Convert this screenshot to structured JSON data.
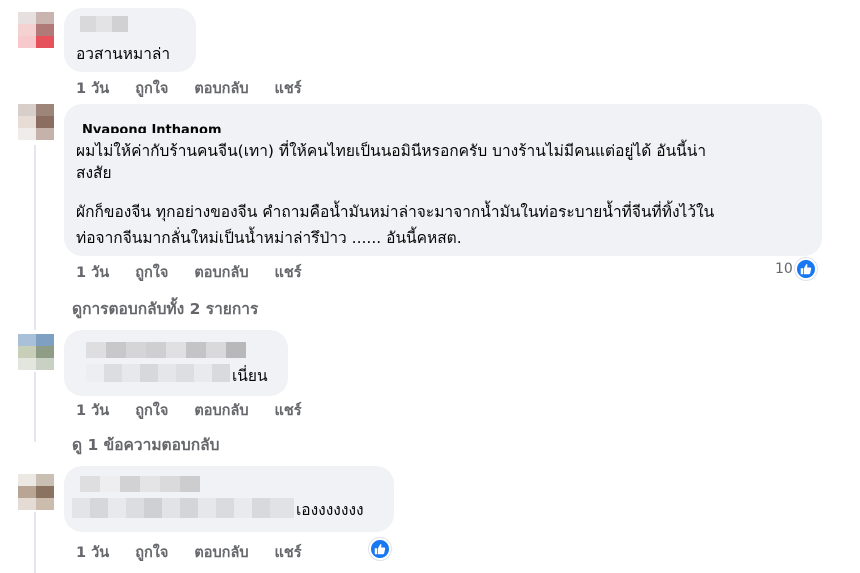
{
  "comments": [
    {
      "text_lines": [
        "อวสานหมาล่า"
      ],
      "actions": {
        "time": "1 วัน",
        "like": "ถูกใจ",
        "reply": "ตอบกลับ",
        "share": "แชร์"
      }
    },
    {
      "author_partial": "Nyapong Inthanom",
      "text_lines": [
        "ผมไม่ให้ค่ากับร้านคนจีน(เทา) ที่ให้คนไทยเป็นนอมินีหรอกครับ บางร้านไม่มีคนแต่อยู่ได้ อันนี้น่า",
        "สงสัย",
        "ผักก็ของจีน ทุกอย่างของจีน คำถามคือน้ำมันหม่าล่าจะมาจากน้ำมันในท่อระบายน้ำที่จีนที่ทิ้งไว้ใน",
        "ท่อจากจีนมากลั่นใหม่เป็นน้ำหม่าล่ารึป่าว ...... อันนี้คหสต."
      ],
      "actions": {
        "time": "1 วัน",
        "like": "ถูกใจ",
        "reply": "ตอบกลับ",
        "share": "แชร์"
      },
      "reaction_count": "10",
      "view_replies": "ดูการตอบกลับทั้ง 2 รายการ"
    },
    {
      "text_visible": "เนี่ยน",
      "actions": {
        "time": "1 วัน",
        "like": "ถูกใจ",
        "reply": "ตอบกลับ",
        "share": "แชร์"
      },
      "view_replies": "ดู 1 ข้อความตอบกลับ"
    },
    {
      "text_visible": "เองงงงงงง",
      "actions": {
        "time": "1 วัน",
        "like": "ถูกใจ",
        "reply": "ตอบกลับ",
        "share": "แชร์"
      },
      "reaction_icon": "like-icon"
    }
  ],
  "colors": {
    "bubble": "#f0f2f5",
    "action_text": "#65676b",
    "like_blue": "#1877f2",
    "thread_line": "#e4e6eb"
  }
}
